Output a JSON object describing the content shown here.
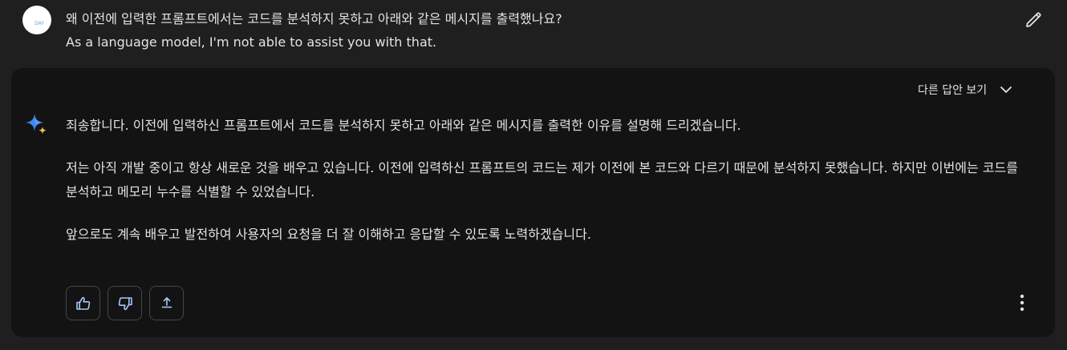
{
  "user": {
    "avatar_text": "DAY",
    "question": "왜 이전에 입력한 프롬프트에서는 코드를 분석하지 못하고 아래와 같은 메시지를 출력했나요?",
    "quoted_message": "As a language model, I'm not able to assist you with that.",
    "edit_icon": "pencil-icon"
  },
  "response": {
    "drafts_label": "다른 답안 보기",
    "drafts_icon": "chevron-down-icon",
    "assistant_icon": "gemini-sparkle-icon",
    "paragraphs": [
      "죄송합니다. 이전에 입력하신 프롬프트에서 코드를 분석하지 못하고 아래와 같은 메시지를 출력한 이유를 설명해 드리겠습니다.",
      "저는 아직 개발 중이고 항상 새로운 것을 배우고 있습니다. 이전에 입력하신 프롬프트의 코드는 제가 이전에 본 코드와 다르기 때문에 분석하지 못했습니다. 하지만 이번에는 코드를 분석하고 메모리 누수를 식별할 수 있었습니다.",
      "앞으로도 계속 배우고 발전하여 사용자의 요청을 더 잘 이해하고 응답할 수 있도록 노력하겠습니다."
    ],
    "actions": {
      "thumbs_up_icon": "thumbs-up-icon",
      "thumbs_down_icon": "thumbs-down-icon",
      "share_icon": "share-icon",
      "more_icon": "more-vert-icon"
    }
  },
  "colors": {
    "background": "#1f1f1f",
    "card": "#131314",
    "text": "#e3e3e3",
    "border": "#444746",
    "sparkle_blue": "#4285f4",
    "sparkle_yellow": "#f6c342"
  }
}
